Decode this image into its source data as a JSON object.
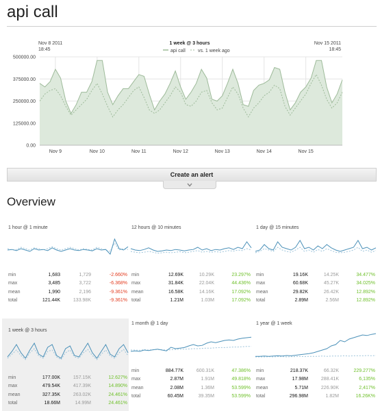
{
  "page": {
    "title": "api call"
  },
  "main_chart": {
    "start_label": "Nov 8 2011",
    "start_time": "18:45",
    "end_label": "Nov 15 2011",
    "end_time": "18:45",
    "title": "1 week @ 3 hours",
    "legend_current": "api call",
    "legend_previous": "vs. 1 week ago"
  },
  "chart_data": {
    "type": "area",
    "title": "1 week @ 3 hours",
    "x_tick_labels": [
      "Nov 9",
      "Nov 10",
      "Nov 11",
      "Nov 12",
      "Nov 13",
      "Nov 14",
      "Nov 15"
    ],
    "y_tick_labels": [
      "0.00",
      "125000.00",
      "250000.00",
      "375000.00",
      "500000.00"
    ],
    "ylim": [
      0,
      500000
    ],
    "grid": true,
    "legend_placement": "top-center",
    "series": [
      {
        "name": "api call",
        "style": "filled-area",
        "values": [
          350000,
          330000,
          360000,
          430000,
          380000,
          250000,
          180000,
          230000,
          300000,
          300000,
          360000,
          480000,
          480000,
          300000,
          230000,
          280000,
          320000,
          320000,
          360000,
          400000,
          390000,
          290000,
          200000,
          250000,
          290000,
          350000,
          420000,
          330000,
          260000,
          300000,
          350000,
          430000,
          380000,
          260000,
          250000,
          280000,
          350000,
          430000,
          350000,
          230000,
          220000,
          310000,
          340000,
          350000,
          370000,
          440000,
          430000,
          300000,
          200000,
          240000,
          300000,
          330000,
          380000,
          480000,
          480000,
          330000,
          240000,
          290000,
          370000
        ]
      },
      {
        "name": "vs. 1 week ago",
        "style": "dashed",
        "values": [
          250000,
          290000,
          310000,
          320000,
          280000,
          220000,
          170000,
          200000,
          230000,
          260000,
          310000,
          350000,
          290000,
          220000,
          160000,
          200000,
          230000,
          270000,
          310000,
          330000,
          270000,
          200000,
          180000,
          200000,
          240000,
          280000,
          330000,
          300000,
          230000,
          220000,
          250000,
          300000,
          310000,
          240000,
          200000,
          210000,
          270000,
          330000,
          290000,
          210000,
          160000,
          210000,
          240000,
          280000,
          300000,
          340000,
          320000,
          220000,
          170000,
          210000,
          250000,
          290000,
          350000,
          400000,
          340000,
          260000,
          210000,
          240000,
          300000
        ]
      }
    ]
  },
  "alert": {
    "label": "Create an alert"
  },
  "overview": {
    "heading": "Overview",
    "stat_labels": [
      "min",
      "max",
      "mean",
      "total"
    ],
    "panels": [
      {
        "title": "1 hour @ 1 minute",
        "highlight": false,
        "rows": [
          {
            "current": "1,683",
            "previous": "1,729",
            "change": "-2.660%",
            "trend": "neg"
          },
          {
            "current": "3,485",
            "previous": "3,722",
            "change": "-6.368%",
            "trend": "neg"
          },
          {
            "current": "1,990",
            "previous": "2,196",
            "change": "-9.361%",
            "trend": "neg"
          },
          {
            "current": "121.44K",
            "previous": "133.98K",
            "change": "-9.361%",
            "trend": "neg"
          }
        ]
      },
      {
        "title": "12 hours @ 10 minutes",
        "highlight": false,
        "rows": [
          {
            "current": "12.69K",
            "previous": "10.29K",
            "change": "23.297%",
            "trend": "pos"
          },
          {
            "current": "31.84K",
            "previous": "22.04K",
            "change": "44.436%",
            "trend": "pos"
          },
          {
            "current": "16.58K",
            "previous": "14.16K",
            "change": "17.092%",
            "trend": "pos"
          },
          {
            "current": "1.21M",
            "previous": "1.03M",
            "change": "17.092%",
            "trend": "pos"
          }
        ]
      },
      {
        "title": "1 day @ 15 minutes",
        "highlight": false,
        "rows": [
          {
            "current": "19.16K",
            "previous": "14.25K",
            "change": "34.477%",
            "trend": "pos"
          },
          {
            "current": "60.68K",
            "previous": "45.27K",
            "change": "34.025%",
            "trend": "pos"
          },
          {
            "current": "29.82K",
            "previous": "26.42K",
            "change": "12.892%",
            "trend": "pos"
          },
          {
            "current": "2.89M",
            "previous": "2.56M",
            "change": "12.892%",
            "trend": "pos"
          }
        ]
      },
      {
        "title": "1 week @ 3 hours",
        "highlight": true,
        "rows": [
          {
            "current": "177.00K",
            "previous": "157.15K",
            "change": "12.627%",
            "trend": "pos"
          },
          {
            "current": "479.54K",
            "previous": "417.39K",
            "change": "14.890%",
            "trend": "pos"
          },
          {
            "current": "327.35K",
            "previous": "263.02K",
            "change": "24.461%",
            "trend": "pos"
          },
          {
            "current": "18.66M",
            "previous": "14.99M",
            "change": "24.461%",
            "trend": "pos"
          }
        ]
      },
      {
        "title": "1 month @ 1 day",
        "highlight": false,
        "rows": [
          {
            "current": "884.77K",
            "previous": "600.31K",
            "change": "47.386%",
            "trend": "pos"
          },
          {
            "current": "2.87M",
            "previous": "1.91M",
            "change": "49.818%",
            "trend": "pos"
          },
          {
            "current": "2.08M",
            "previous": "1.36M",
            "change": "53.599%",
            "trend": "pos"
          },
          {
            "current": "60.45M",
            "previous": "39.35M",
            "change": "53.599%",
            "trend": "pos"
          }
        ]
      },
      {
        "title": "1 year @ 1 week",
        "highlight": false,
        "rows": [
          {
            "current": "218.37K",
            "previous": "66.32K",
            "change": "229.277%",
            "trend": "pos"
          },
          {
            "current": "17.98M",
            "previous": "288.41K",
            "change": "6,135%",
            "trend": "pos"
          },
          {
            "current": "5.71M",
            "previous": "226.90K",
            "change": "2,417%",
            "trend": "pos"
          },
          {
            "current": "296.98M",
            "previous": "1.82M",
            "change": "16.26K%",
            "trend": "pos"
          }
        ]
      }
    ]
  },
  "colors": {
    "area_fill": "#dde9dc",
    "area_line": "#9dba99",
    "spark_line": "#4a90b8",
    "spark_compare": "#9cc3da",
    "positive": "#6fc02b",
    "negative": "#e33b1f",
    "panel_highlight": "#efefef"
  }
}
